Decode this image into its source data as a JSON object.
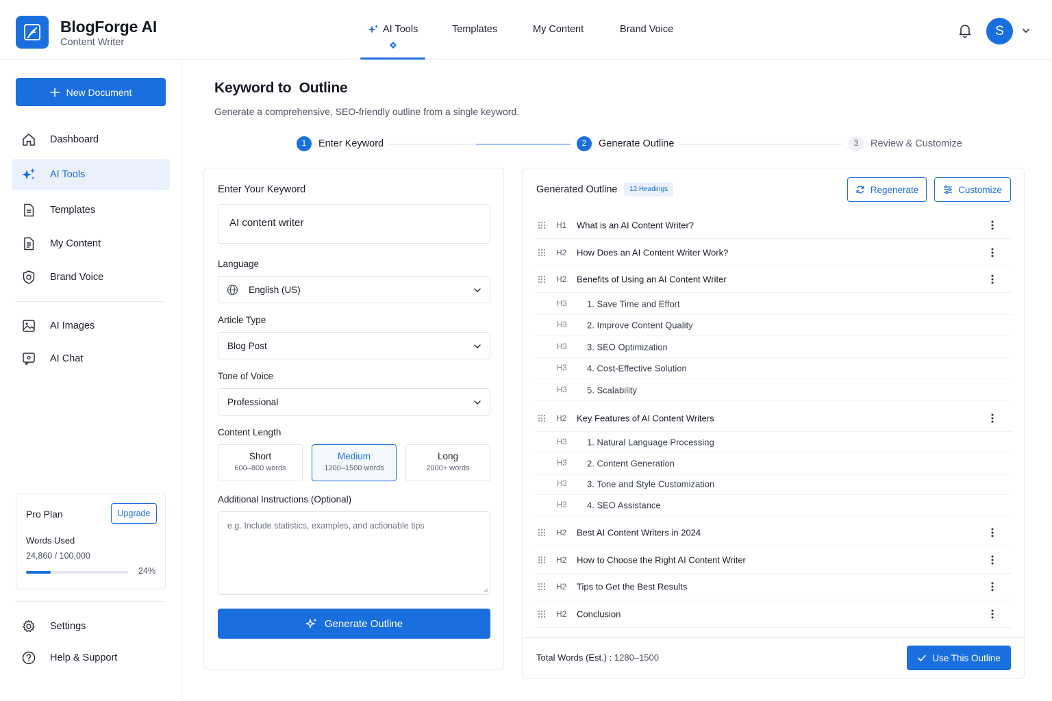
{
  "brand": {
    "title": "BlogForge AI",
    "subtitle": "Content Writer",
    "accent": "#1a6fdf"
  },
  "topnav": {
    "items": [
      {
        "label": "AI Tools",
        "icon": "sparkles-icon",
        "active": true
      },
      {
        "label": "Templates"
      },
      {
        "label": "My Content"
      },
      {
        "label": "Brand Voice"
      }
    ],
    "avatar_initial": "S"
  },
  "sidebar": {
    "new_document": "New Document",
    "items": [
      {
        "label": "Dashboard",
        "icon": "home-icon"
      },
      {
        "label": "AI Tools",
        "icon": "sparkles-icon",
        "active": true
      },
      {
        "label": "Templates",
        "icon": "template-icon"
      },
      {
        "label": "My Content",
        "icon": "document-icon"
      },
      {
        "label": "Brand Voice",
        "icon": "brand-voice-icon"
      },
      {
        "label": "AI Images",
        "icon": "image-icon"
      },
      {
        "label": "AI Chat",
        "icon": "chat-icon"
      }
    ],
    "plan": {
      "name": "Pro Plan",
      "upgrade": "Upgrade",
      "words_used_label": "Words Used",
      "words_count": "24,860 / 100,000",
      "usage_fraction": 0.24,
      "usage_percent": "24%"
    },
    "bottom": [
      {
        "label": "Settings",
        "icon": "gear-icon"
      },
      {
        "label": "Help & Support",
        "icon": "help-icon"
      }
    ]
  },
  "page": {
    "title": "Keyword to  Outline",
    "subtitle": "Generate a comprehensive, SEO-friendly outline from a single keyword."
  },
  "stepper": [
    {
      "num": "1",
      "label": "Enter Keyword",
      "state": "complete"
    },
    {
      "num": "2",
      "label": "Generate Outline",
      "state": "current"
    },
    {
      "num": "3",
      "label": "Review & Customize",
      "state": "upcoming"
    }
  ],
  "form": {
    "keyword_label": "Enter Your Keyword",
    "keyword_value": "AI content writer",
    "language_label": "Language",
    "language_value": "English (US)",
    "article_type_label": "Article Type",
    "article_type_value": "Blog Post",
    "tone_label": "Tone of Voice",
    "tone_value": "Professional",
    "length_label": "Content Length",
    "lengths": [
      {
        "title": "Short",
        "sub": "600–800 words"
      },
      {
        "title": "Medium",
        "sub": "1200–1500 words",
        "selected": true
      },
      {
        "title": "Long",
        "sub": "2000+ words"
      }
    ],
    "instructions_label": "Additional Instructions (Optional)",
    "instructions_placeholder": "e.g. Include statistics, examples, and actionable tips",
    "generate_button": "Generate Outline"
  },
  "outline": {
    "title": "Generated Outline",
    "badge": "12 Headings",
    "regenerate": "Regenerate",
    "customize": "Customize",
    "rows": [
      {
        "tag": "H1",
        "text": "What is an AI Content Writer?"
      },
      {
        "tag": "H2",
        "text": "How Does an AI Content Writer Work?"
      },
      {
        "tag": "H2",
        "text": "Benefits of Using an AI Content Writer"
      },
      {
        "tag": "H3",
        "text": "1. Save Time and Effort"
      },
      {
        "tag": "H3",
        "text": "2. Improve Content Quality"
      },
      {
        "tag": "H3",
        "text": "3. SEO Optimization"
      },
      {
        "tag": "H3",
        "text": "4. Cost-Effective Solution"
      },
      {
        "tag": "H3",
        "text": "5. Scalability"
      },
      {
        "tag": "H2",
        "text": "Key Features of AI Content Writers"
      },
      {
        "tag": "H3",
        "text": "1. Natural Language Processing"
      },
      {
        "tag": "H3",
        "text": "2. Content Generation"
      },
      {
        "tag": "H3",
        "text": "3. Tone and Style Customization"
      },
      {
        "tag": "H3",
        "text": "4. SEO Assistance"
      },
      {
        "tag": "H2",
        "text": "Best AI Content Writers in 2024"
      },
      {
        "tag": "H2",
        "text": "How to Choose the Right AI Content Writer"
      },
      {
        "tag": "H2",
        "text": "Tips to Get the Best Results"
      },
      {
        "tag": "H2",
        "text": "Conclusion"
      }
    ],
    "total_words_label": "Total Words (Est.) :",
    "total_words_value": "1280–1500",
    "use_button": "Use This Outline"
  }
}
